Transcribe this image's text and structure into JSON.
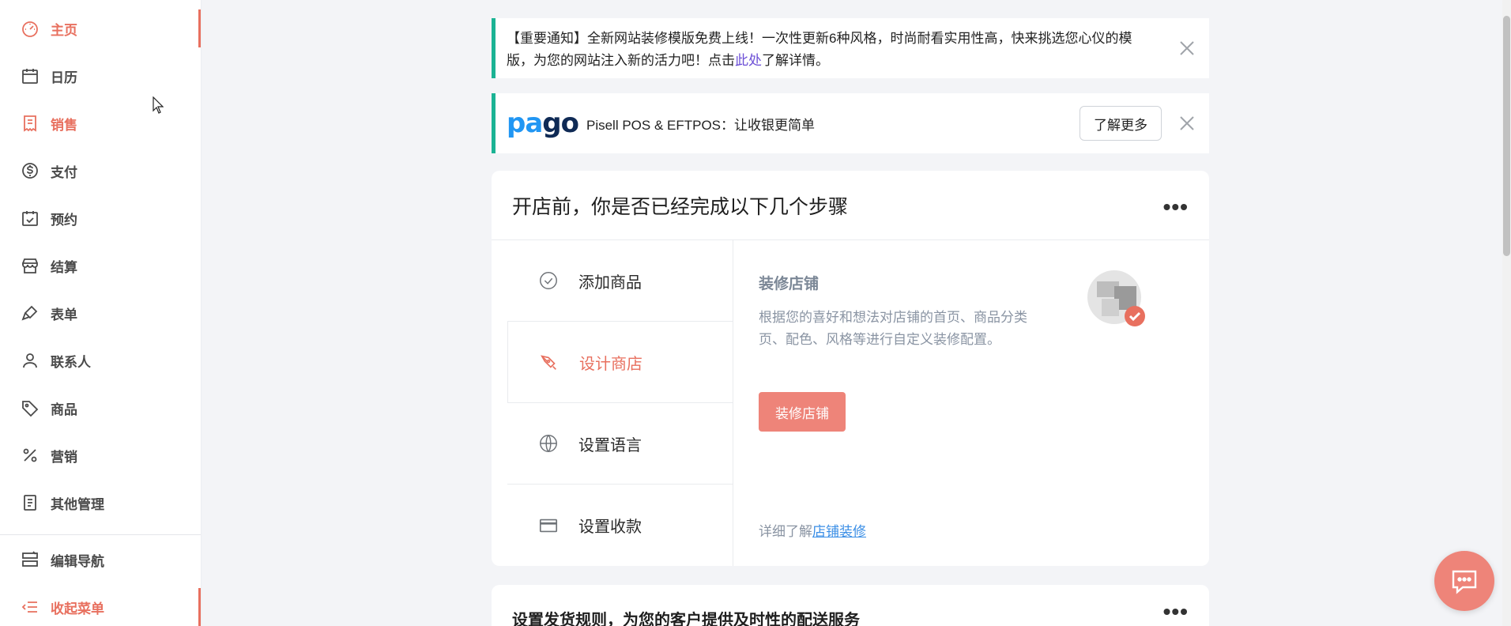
{
  "sidebar": {
    "items": [
      {
        "label": "主页",
        "icon": "dashboard-icon",
        "active": true
      },
      {
        "label": "日历",
        "icon": "calendar-icon"
      },
      {
        "label": "销售",
        "icon": "receipt-icon",
        "highlight": true
      },
      {
        "label": "支付",
        "icon": "dollar-icon"
      },
      {
        "label": "预约",
        "icon": "calendar-check-icon"
      },
      {
        "label": "结算",
        "icon": "store-icon"
      },
      {
        "label": "表单",
        "icon": "brush-icon"
      },
      {
        "label": "联系人",
        "icon": "user-icon"
      },
      {
        "label": "商品",
        "icon": "tag-icon"
      },
      {
        "label": "营销",
        "icon": "percent-icon"
      },
      {
        "label": "其他管理",
        "icon": "document-icon"
      }
    ],
    "edit_nav": "编辑导航",
    "collapse_menu": "收起菜单"
  },
  "notice": {
    "text_before": "【重要通知】全新网站装修模版免费上线！一次性更新6种风格，时尚耐看实用性高，快来挑选您心仪的模版，为您的网站注入新的活力吧！点击",
    "link": "此处",
    "text_after": "了解详情。"
  },
  "promo": {
    "logo_pa": "pa",
    "logo_go": "go",
    "text": "Pisell POS & EFTPOS：让收银更简单",
    "button": "了解更多"
  },
  "setup_card": {
    "title": "开店前，你是否已经完成以下几个步骤",
    "more": "•••",
    "steps": [
      {
        "label": "添加商品",
        "icon": "check-circle-icon"
      },
      {
        "label": "设计商店",
        "icon": "pen-icon",
        "active": true
      },
      {
        "label": "设置语言",
        "icon": "globe-icon"
      },
      {
        "label": "设置收款",
        "icon": "credit-card-icon"
      }
    ],
    "detail": {
      "title": "装修店铺",
      "description": "根据您的喜好和想法对店铺的首页、商品分类页、配色、风格等进行自定义装修配置。",
      "button": "装修店铺",
      "learn_prefix": "详细了解",
      "learn_link": "店铺装修"
    }
  },
  "shipping_card": {
    "title": "设置发货规则，为您的客户提供及时性的配送服务",
    "more": "•••"
  },
  "colors": {
    "accent": "#e8705f",
    "notice_border": "#1bb394",
    "link": "#6c4fd6"
  }
}
